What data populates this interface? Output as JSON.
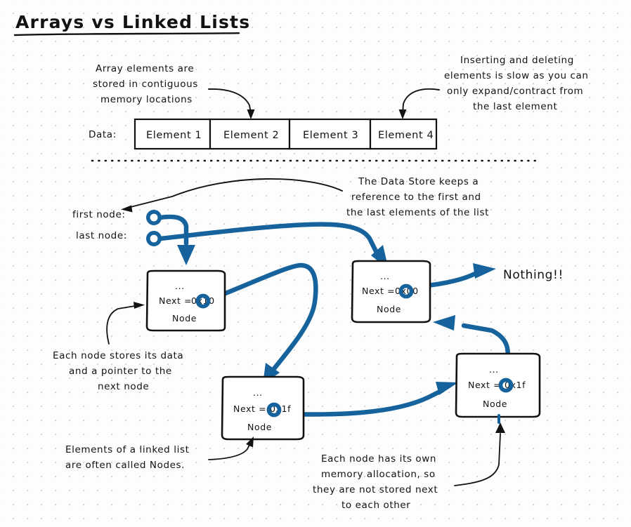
{
  "page": {
    "title": "Arrays vs Linked Lists",
    "background_color": "#fdfdfd",
    "ink_color": "#121212",
    "accent_color": "#15629D"
  },
  "array_section": {
    "annotation_left": [
      "Array elements are",
      "stored in contiguous",
      "memory locations"
    ],
    "annotation_right": [
      "Inserting and deleting",
      "elements is slow as you can",
      "only expand/contract from",
      "the last element"
    ],
    "data_label": "Data:",
    "cells": [
      "Element 1",
      "Element 2",
      "Element 3",
      "Element 4"
    ]
  },
  "linked_section": {
    "store_annotation": [
      "The Data Store keeps a",
      "reference to the first and",
      "the last elements of the list"
    ],
    "first_node_label": "first node:",
    "last_node_label": "last node:",
    "end_label": "Nothing!!",
    "node_annotation": [
      "Each node stores its data",
      "and a pointer to the",
      "next node"
    ],
    "elements_annotation": [
      "Elements of a linked list",
      "are often called Nodes."
    ],
    "memory_annotation": [
      "Each node has its own",
      "memory allocation, so",
      "they are not stored next",
      "to each other"
    ],
    "nodes": [
      {
        "id": "node-1",
        "ellipsis": "...",
        "next_label": "Next =",
        "next_value": "0x10",
        "type_label": "Node"
      },
      {
        "id": "node-2",
        "ellipsis": "...",
        "next_label": "Next =",
        "next_value": "0x00",
        "type_label": "Node"
      },
      {
        "id": "node-3",
        "ellipsis": "...",
        "next_label": "Next =",
        "next_value": "0x1f",
        "type_label": "Node"
      },
      {
        "id": "node-4",
        "ellipsis": "...",
        "next_label": "Next =",
        "next_value": "0x1f",
        "type_label": "Node"
      }
    ]
  }
}
